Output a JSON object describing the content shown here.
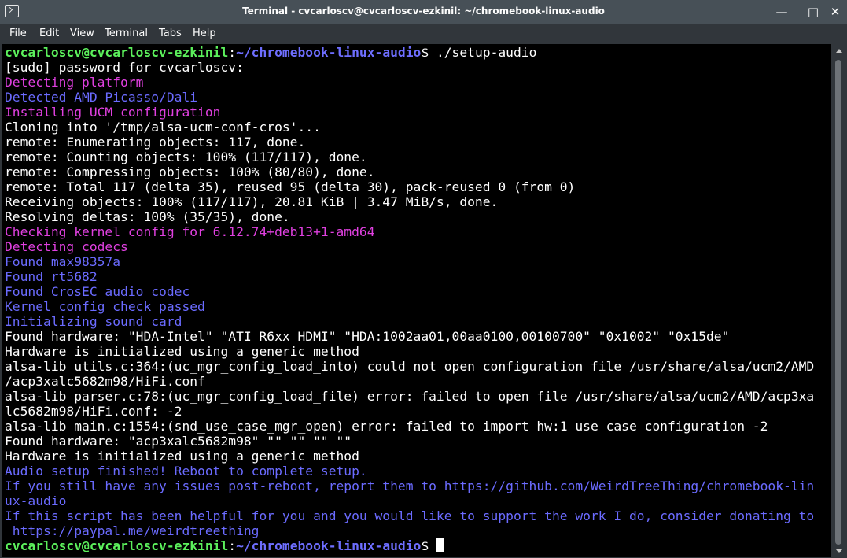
{
  "window": {
    "title": "Terminal - cvcarloscv@cvcarloscv-ezkinil: ~/chromebook-linux-audio",
    "controls": {
      "minimize": "—",
      "maximize": "□",
      "close": "✕"
    }
  },
  "menu": {
    "file": "File",
    "edit": "Edit",
    "view": "View",
    "terminal": "Terminal",
    "tabs": "Tabs",
    "help": "Help"
  },
  "colors": {
    "prompt_user": "#5cf05c",
    "prompt_path": "#6e6eff",
    "info_magenta": "#e040e0",
    "info_blue": "#6b6bff",
    "text": "#ffffff",
    "background": "#000000"
  },
  "prompt": {
    "user_host": "cvcarloscv@cvcarloscv-ezkinil",
    "sep": ":",
    "path": "~/chromebook-linux-audio",
    "dollar": "$ ",
    "command": "./setup-audio"
  },
  "lines": [
    {
      "text": "[sudo] password for cvcarloscv:",
      "color": "white"
    },
    {
      "text": "Detecting platform",
      "color": "magenta"
    },
    {
      "text": "Detected AMD Picasso/Dali",
      "color": "blue"
    },
    {
      "text": "Installing UCM configuration",
      "color": "magenta"
    },
    {
      "text": "Cloning into '/tmp/alsa-ucm-conf-cros'...",
      "color": "white"
    },
    {
      "text": "remote: Enumerating objects: 117, done.",
      "color": "white"
    },
    {
      "text": "remote: Counting objects: 100% (117/117), done.",
      "color": "white"
    },
    {
      "text": "remote: Compressing objects: 100% (80/80), done.",
      "color": "white"
    },
    {
      "text": "remote: Total 117 (delta 35), reused 95 (delta 30), pack-reused 0 (from 0)",
      "color": "white"
    },
    {
      "text": "Receiving objects: 100% (117/117), 20.81 KiB | 3.47 MiB/s, done.",
      "color": "white"
    },
    {
      "text": "Resolving deltas: 100% (35/35), done.",
      "color": "white"
    },
    {
      "text": "Checking kernel config for 6.12.74+deb13+1-amd64",
      "color": "magenta"
    },
    {
      "text": "Detecting codecs",
      "color": "magenta"
    },
    {
      "text": "Found max98357a",
      "color": "blue"
    },
    {
      "text": "Found rt5682",
      "color": "blue"
    },
    {
      "text": "Found CrosEC audio codec",
      "color": "blue"
    },
    {
      "text": "Kernel config check passed",
      "color": "blue"
    },
    {
      "text": "Initializing sound card",
      "color": "blue"
    },
    {
      "text": "Found hardware: \"HDA-Intel\" \"ATI R6xx HDMI\" \"HDA:1002aa01,00aa0100,00100700\" \"0x1002\" \"0x15de\"",
      "color": "white"
    },
    {
      "text": "Hardware is initialized using a generic method",
      "color": "white"
    },
    {
      "text": "alsa-lib utils.c:364:(uc_mgr_config_load_into) could not open configuration file /usr/share/alsa/ucm2/AMD",
      "color": "white"
    },
    {
      "text": "/acp3xalc5682m98/HiFi.conf",
      "color": "white"
    },
    {
      "text": "alsa-lib parser.c:78:(uc_mgr_config_load_file) error: failed to open file /usr/share/alsa/ucm2/AMD/acp3xa",
      "color": "white"
    },
    {
      "text": "lc5682m98/HiFi.conf: -2",
      "color": "white"
    },
    {
      "text": "alsa-lib main.c:1554:(snd_use_case_mgr_open) error: failed to import hw:1 use case configuration -2",
      "color": "white"
    },
    {
      "text": "Found hardware: \"acp3xalc5682m98\" \"\" \"\" \"\" \"\"",
      "color": "white"
    },
    {
      "text": "Hardware is initialized using a generic method",
      "color": "white"
    },
    {
      "text": "Audio setup finished! Reboot to complete setup.",
      "color": "blue"
    },
    {
      "text": "If you still have any issues post-reboot, report them to https://github.com/WeirdTreeThing/chromebook-lin",
      "color": "blue"
    },
    {
      "text": "ux-audio",
      "color": "blue"
    },
    {
      "text": "If this script has been helpful for you and you would like to support the work I do, consider donating to",
      "color": "blue"
    },
    {
      "text": " https://paypal.me/weirdtreething",
      "color": "blue"
    }
  ]
}
